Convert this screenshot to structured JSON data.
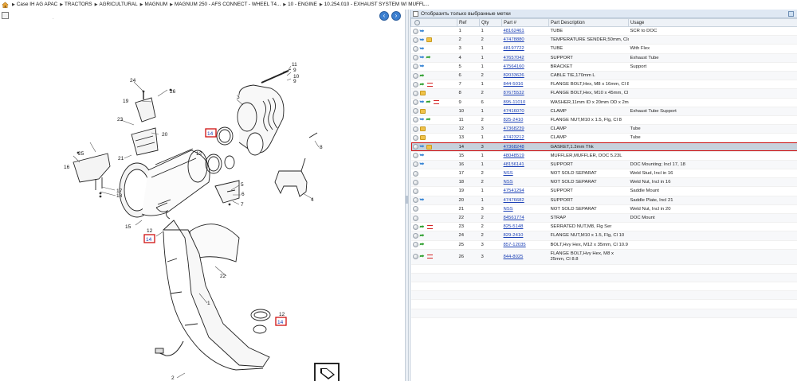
{
  "breadcrumb": [
    "Case IH AG APAC",
    "TRACTORS",
    "AGRICULTURAL",
    "MAGNUM",
    "MAGNUM 250 - AFS CONNECT - WHEEL T4...",
    "10 - ENGINE",
    "10.254.010 - EXHAUST SYSTEM W/ MUFFL..."
  ],
  "filter": {
    "label": "Отобразить только выбранные метки"
  },
  "columns": [
    "Ref",
    "Qty",
    "Part #",
    "Part Description",
    "Usage"
  ],
  "parts": [
    {
      "ref": "1",
      "qty": "1",
      "part": "48162461",
      "desc": "TUBE",
      "usage": "SCR to DOC",
      "icons": [
        "hook"
      ]
    },
    {
      "ref": "2",
      "qty": "2",
      "part": "47478880",
      "desc": "TEMPERATURE SENDER,50mm, Closed",
      "usage": "",
      "icons": [
        "hook",
        "box"
      ]
    },
    {
      "ref": "3",
      "qty": "1",
      "part": "48197722",
      "desc": "TUBE",
      "usage": "With Flex",
      "icons": [
        "hook"
      ]
    },
    {
      "ref": "4",
      "qty": "1",
      "part": "47657042",
      "desc": "SUPPORT",
      "usage": "Exhaust Tube",
      "icons": [
        "hook",
        "leaf"
      ]
    },
    {
      "ref": "5",
      "qty": "1",
      "part": "47564160",
      "desc": "BRACKET",
      "usage": "Support",
      "icons": [
        "hook"
      ]
    },
    {
      "ref": "6",
      "qty": "2",
      "part": "82033626",
      "desc": "CABLE TIE,170mm L",
      "usage": "",
      "icons": [
        "leaf"
      ]
    },
    {
      "ref": "7",
      "qty": "1",
      "part": "844-5016",
      "desc": "FLANGE BOLT,Hex, M8 x 16mm, Cl 8.8",
      "usage": "",
      "icons": [
        "leaf",
        "bars"
      ]
    },
    {
      "ref": "8",
      "qty": "2",
      "part": "87675532",
      "desc": "FLANGE BOLT,Hex, M10 x 45mm, Cl 10.9",
      "usage": "",
      "icons": [
        "box"
      ]
    },
    {
      "ref": "9",
      "qty": "6",
      "part": "895-11010",
      "desc": "WASHER,11mm ID x 20mm OD x 2mm Thk",
      "usage": "",
      "icons": [
        "hook",
        "leaf",
        "bars"
      ]
    },
    {
      "ref": "10",
      "qty": "1",
      "part": "47416070",
      "desc": "CLAMP",
      "usage": "Exhaust Tube Support",
      "icons": [
        "box"
      ]
    },
    {
      "ref": "11",
      "qty": "2",
      "part": "825-2410",
      "desc": "FLANGE NUT,M10 x 1.5, Flg, Cl 8",
      "usage": "",
      "icons": [
        "hook",
        "leaf"
      ]
    },
    {
      "ref": "12",
      "qty": "3",
      "part": "47368239",
      "desc": "CLAMP",
      "usage": "Tube",
      "icons": [
        "box"
      ]
    },
    {
      "ref": "13",
      "qty": "1",
      "part": "47423212",
      "desc": "CLAMP",
      "usage": "Tube",
      "icons": [
        "box"
      ]
    },
    {
      "ref": "14",
      "qty": "3",
      "part": "47368248",
      "desc": "GASKET,1.3mm Thk",
      "usage": "",
      "icons": [
        "hook",
        "box"
      ],
      "selected": true
    },
    {
      "ref": "15",
      "qty": "1",
      "part": "48048519",
      "desc": "MUFFLER,MUFFLER, DOC 5.23L",
      "usage": "",
      "icons": [
        "hook"
      ]
    },
    {
      "ref": "16",
      "qty": "1",
      "part": "48156141",
      "desc": "SUPPORT",
      "usage": "DOC Mounting; Incl 17, 18",
      "icons": [
        "hook"
      ]
    },
    {
      "ref": "17",
      "qty": "2",
      "part": "NSS",
      "desc": "NOT SOLD SEPARAT",
      "usage": "Weld Stud, Incl in 16",
      "icons": []
    },
    {
      "ref": "18",
      "qty": "2",
      "part": "NSS",
      "desc": "NOT SOLD SEPARAT",
      "usage": "Weld Nut, Incl in 16",
      "icons": []
    },
    {
      "ref": "19",
      "qty": "1",
      "part": "47541294",
      "desc": "SUPPORT",
      "usage": "Saddle Mount",
      "icons": []
    },
    {
      "ref": "20",
      "qty": "1",
      "part": "47476682",
      "desc": "SUPPORT",
      "usage": "Saddle Plate, Incl 21",
      "icons": [
        "hook"
      ]
    },
    {
      "ref": "21",
      "qty": "3",
      "part": "NSS",
      "desc": "NOT SOLD SEPARAT",
      "usage": "Weld Nut, Incl in 20",
      "icons": []
    },
    {
      "ref": "22",
      "qty": "2",
      "part": "84561774",
      "desc": "STRAP",
      "usage": "DOC Mount",
      "icons": []
    },
    {
      "ref": "23",
      "qty": "2",
      "part": "825-5148",
      "desc": "SERRATED NUT,M8, Flg Ser",
      "usage": "",
      "icons": [
        "leaf",
        "bars"
      ]
    },
    {
      "ref": "24",
      "qty": "2",
      "part": "829-2410",
      "desc": "FLANGE NUT,M10 x 1.5, Flg, Cl 10",
      "usage": "",
      "icons": [
        "leaf"
      ]
    },
    {
      "ref": "25",
      "qty": "3",
      "part": "857-12035",
      "desc": "BOLT,Hvy Hex, M12 x 35mm, Cl 10.9",
      "usage": "",
      "icons": [
        "leaf"
      ]
    },
    {
      "ref": "26",
      "qty": "3",
      "part": "844-8025",
      "desc": "FLANGE BOLT,Hvy Hex, M8 x 25mm, Cl 8.8",
      "usage": "",
      "icons": [
        "leaf",
        "bars"
      ],
      "tall": true
    }
  ],
  "diagram_callouts": [
    "11",
    "9",
    "10",
    "9",
    "24",
    "26",
    "19",
    "3",
    "23",
    "20",
    "13",
    "14",
    "12",
    "8",
    "25",
    "16",
    "21",
    "17",
    "18",
    "5",
    "6",
    "7",
    "4",
    "15",
    "12",
    "14",
    "22",
    "1",
    "12",
    "14",
    "2"
  ]
}
